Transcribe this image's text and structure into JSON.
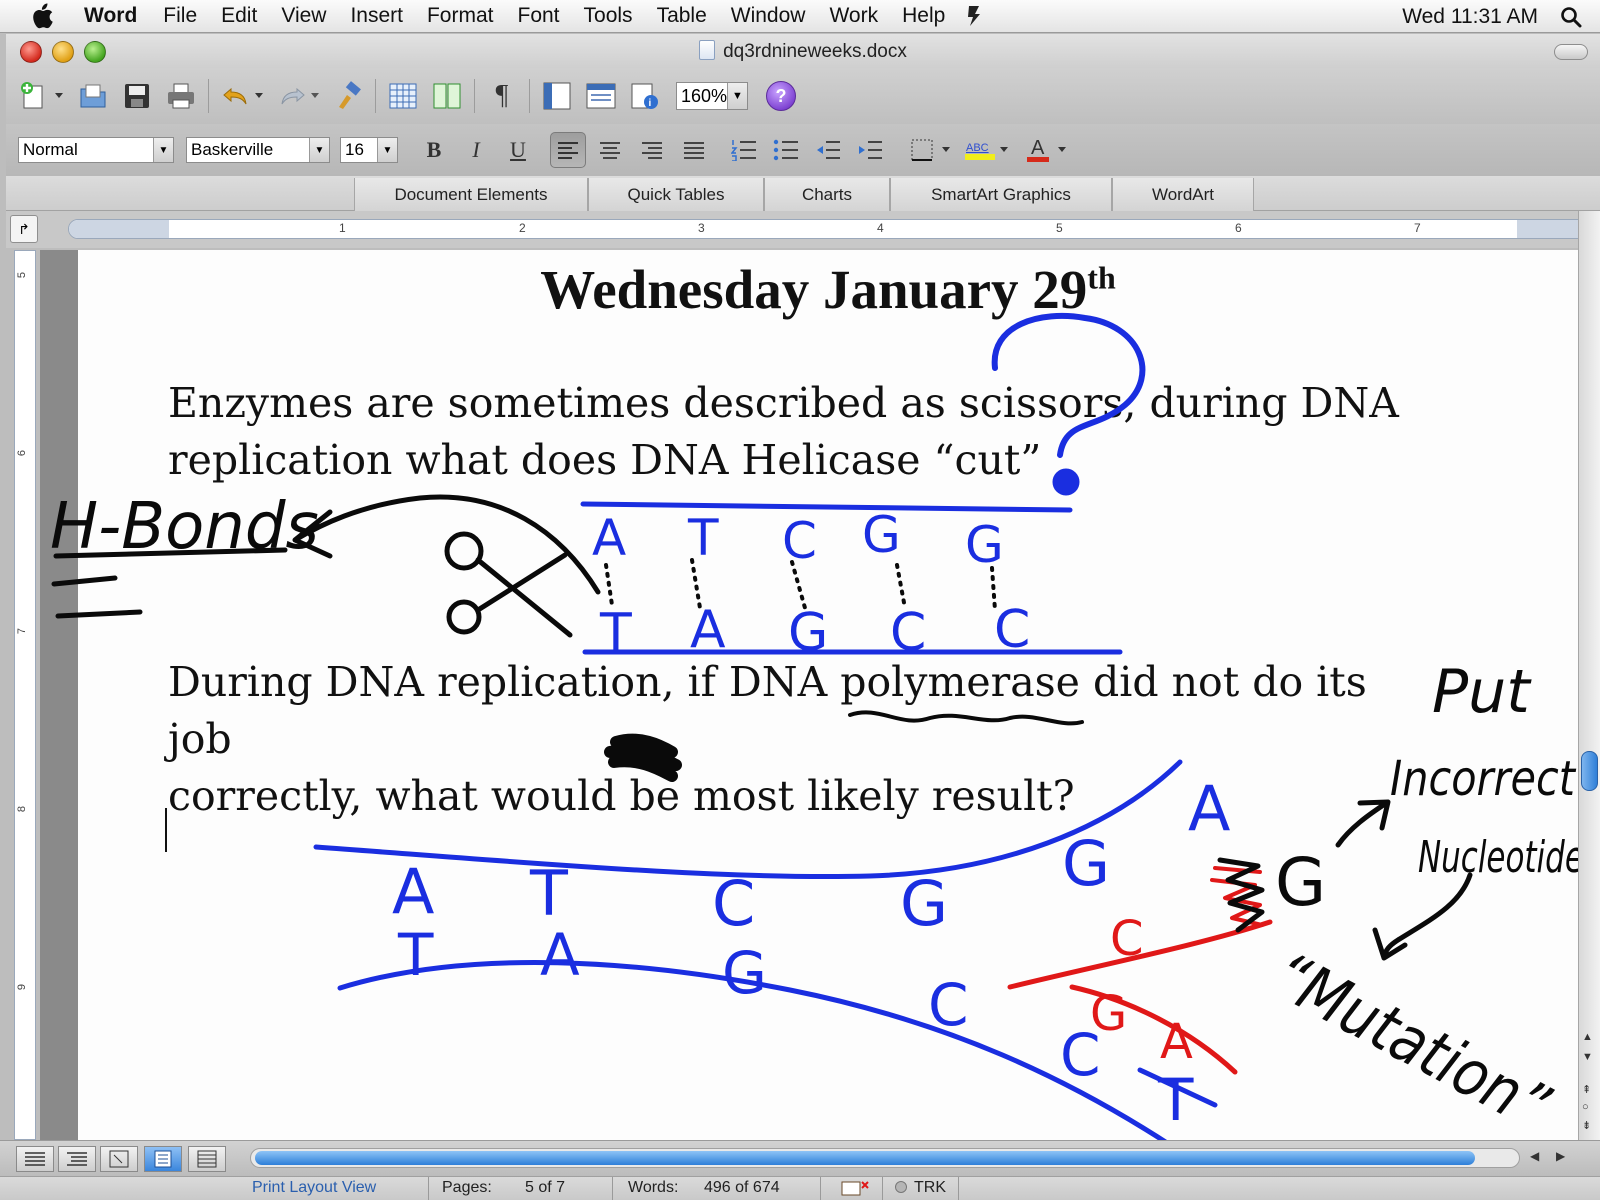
{
  "menubar": {
    "app": "Word",
    "items": [
      "File",
      "Edit",
      "View",
      "Insert",
      "Format",
      "Font",
      "Tools",
      "Table",
      "Window",
      "Work",
      "Help"
    ],
    "clock": "Wed 11:31 AM"
  },
  "window": {
    "title": "dq3rdnineweeks.docx"
  },
  "toolbar": {
    "zoom": "160%"
  },
  "formatting": {
    "style": "Normal",
    "font": "Baskerville",
    "size": "16"
  },
  "ribbon": {
    "tabs": [
      "Document Elements",
      "Quick Tables",
      "Charts",
      "SmartArt Graphics",
      "WordArt"
    ]
  },
  "ruler": {
    "numbers": [
      "1",
      "2",
      "3",
      "4",
      "5",
      "6",
      "7"
    ],
    "vnumbers": [
      "5",
      "6",
      "7",
      "8",
      "9"
    ]
  },
  "document": {
    "title_main": "Wednesday January 29",
    "title_sup": "th",
    "para1_line1": "Enzymes are sometimes described as scissors, during DNA",
    "para1_line2": "replication what does DNA Helicase “cut”",
    "para2_line1": "During DNA replication, if DNA polymerase did not do its job",
    "para2_line2": "correctly, what would be most likely result?"
  },
  "annotations": {
    "left_label": "H-Bonds",
    "top_strand": [
      "A",
      "T",
      "C",
      "G",
      "G"
    ],
    "bottom_strand": [
      "T",
      "A",
      "G",
      "C",
      "C"
    ],
    "lower_top": [
      "A",
      "T",
      "C",
      "G",
      "G",
      "A"
    ],
    "lower_bottom": [
      "T",
      "A",
      "G",
      "C",
      "C",
      "T"
    ],
    "new_strand_red": [
      "C",
      "G",
      "A"
    ],
    "wrong_base": "G",
    "right_notes": [
      "Put",
      "Incorrect",
      "Nucleotides",
      "“Mutation”"
    ],
    "ink_colors": {
      "blue": "#1a2ee0",
      "black": "#0a0a0a",
      "red": "#e01818"
    }
  },
  "status": {
    "view": "Print Layout View",
    "pages_label": "Pages:",
    "pages_value": "5 of 7",
    "words_label": "Words:",
    "words_value": "496 of 674",
    "trk": "TRK"
  }
}
